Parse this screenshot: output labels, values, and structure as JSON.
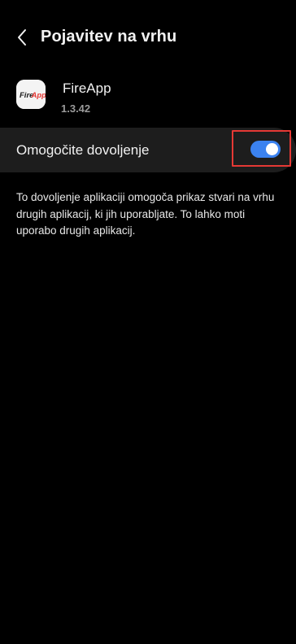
{
  "header": {
    "title": "Pojavitev na vrhu",
    "back_icon": "chevron-left-icon"
  },
  "app": {
    "name": "FireApp",
    "version": "1.3.42",
    "icon_text": "FireApp",
    "icon_colors": {
      "bg": "#f4f4f4",
      "text_primary": "#e53935",
      "text_secondary": "#1a1a1a"
    }
  },
  "permission": {
    "label": "Omogočite dovoljenje",
    "enabled": true,
    "toggle_color": "#3b82f0",
    "highlight_color": "#e53935"
  },
  "description": "To dovoljenje aplikaciji omogoča prikaz stvari na vrhu drugih aplikacij, ki jih uporabljate. To lahko moti uporabo drugih aplikacij."
}
